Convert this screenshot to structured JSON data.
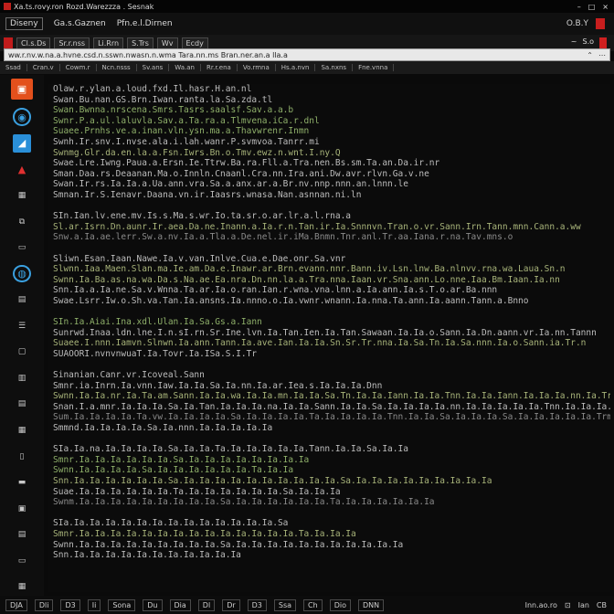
{
  "window": {
    "title": "Xa.ts.rovy.ron  Rozd.Warezzza . Sesnak",
    "controls": [
      "–",
      "□",
      "×"
    ]
  },
  "menubar": {
    "items": [
      "Diseny",
      "Ga.s.Gaznen",
      "Pfn.e.l.Dirnen"
    ],
    "right_label": "O.B.Y"
  },
  "toolbar": {
    "buttons": [
      "Cl.s.Ds",
      "Sr.r.nss",
      "Li.Rrn",
      "S.Trs",
      "Wv",
      "Ecdy"
    ],
    "right_labels": [
      "~",
      "S.o"
    ]
  },
  "address": {
    "text": "ww.r.nv.w.na.a.hvne.csd.n.sswn.nwasn.n.wma  Tara.nn.ms   Bran.ner.an.a  lla.a",
    "right_labels": [
      "⌃",
      "⋯"
    ]
  },
  "tabs": [
    "Ssad",
    "Cran.v",
    "Cowm.r",
    "Ncn.nsss",
    "Sv.ans",
    "Wa.an",
    "Rr.r.ena",
    "Vo.rmna",
    "Hs.a.nvn",
    "Sa.nxns",
    "Fne.vnna"
  ],
  "dock": {
    "icons": [
      {
        "name": "app-orange-icon",
        "glyph": "▣"
      },
      {
        "name": "globe-icon",
        "glyph": "◉"
      },
      {
        "name": "window-icon",
        "glyph": "◢"
      },
      {
        "name": "alert-icon",
        "glyph": "▲"
      },
      {
        "name": "grid-icon",
        "glyph": "▦"
      },
      {
        "name": "chip-icon",
        "glyph": "⧉"
      },
      {
        "name": "panel-icon",
        "glyph": "▭"
      },
      {
        "name": "drop-icon",
        "glyph": "◍"
      },
      {
        "name": "doc-icon",
        "glyph": "▤"
      },
      {
        "name": "list-icon",
        "glyph": "☰"
      },
      {
        "name": "box-icon",
        "glyph": "▢"
      },
      {
        "name": "page-icon",
        "glyph": "▥"
      },
      {
        "name": "stack-icon",
        "glyph": "▤"
      },
      {
        "name": "layers-icon",
        "glyph": "▦"
      },
      {
        "name": "file-icon",
        "glyph": "▯"
      },
      {
        "name": "folder-icon",
        "glyph": "▬"
      },
      {
        "name": "terminal-icon",
        "glyph": "▣"
      },
      {
        "name": "note-icon",
        "glyph": "▤"
      },
      {
        "name": "monitor-icon",
        "glyph": "▭"
      },
      {
        "name": "bottom-icon",
        "glyph": "▦"
      }
    ]
  },
  "editor": {
    "lines": [
      {
        "text": "Olaw.r.ylan.a.loud.fxd.Il.hasr.H.an.nl",
        "tone": "gray"
      },
      {
        "text": "Swan.Bu.nan.GS.Brn.Iwan.ranta.la.Sa.zda.tl",
        "tone": "gray"
      },
      {
        "text": "Swan.Bwnna.nrscena.Smrs.Tasrs.saalsf.Sav.a.a.b",
        "tone": "green"
      },
      {
        "text": "Swnr.P.a.ul.laluvla.Sav.a.Ta.ra.a.Tlmvena.iCa.r.dnl",
        "tone": "green"
      },
      {
        "text": "Suaee.Prnhs.ve.a.inan.vln.ysn.ma.a.Thavwrenr.Inmn",
        "tone": "green"
      },
      {
        "text": "Swnh.Ir.snv.I.nvse.ala.i.lah.wanr.P.svmvoa.Tanrr.mi",
        "tone": "gray"
      },
      {
        "text": "Swnmg.Glr.da.en.la.a.Fsn.Iwrs.Bn.o.Tmv.ewz.n.wnt.I.ny.Q",
        "tone": "olive"
      },
      {
        "text": "Swae.Lre.Iwng.Paua.a.Ersn.Ie.Ttrw.Ba.ra.Fll.a.Tra.nen.Bs.sm.Ta.an.Da.ir.nr",
        "tone": "gray"
      },
      {
        "text": "Sman.Daa.rs.Deaanan.Ma.o.Innln.Cnaanl.Cra.nn.Ira.ani.Dw.avr.rlvn.Ga.v.ne",
        "tone": "gray"
      },
      {
        "text": "Swan.Ir.rs.Ia.Ia.a.Ua.ann.vra.Sa.a.anx.ar.a.Br.nv.nnp.nnn.an.lnnn.le",
        "tone": "gray"
      },
      {
        "text": "Smnan.Ir.S.Ienavr.Daana.vn.ir.Iaasrs.wnasa.Nan.asnnan.ni.ln",
        "tone": "gray"
      },
      {
        "text": "",
        "tone": "gray"
      },
      {
        "text": "SIn.Ian.lv.ene.mv.Is.s.Ma.s.wr.Io.ta.sr.o.ar.lr.a.l.rna.a",
        "tone": "gray"
      },
      {
        "text": "Sl.ar.Isrn.Dn.aunr.Ir.aea.Da.ne.Inann.a.Ia.r.n.Tan.ir.Ia.Snnnvn.Tran.o.vr.Sann.Irn.Tann.mnn.Cann.a.ww",
        "tone": "olive"
      },
      {
        "text": "Snw.a.Ia.ae.lerr.Sw.a.nv.Ia.a.Tla.a.De.nel.ir.iMa.Bnmn.Tnr.anl.Tr.aa.Iana.r.na.Tav.mns.o",
        "tone": "dim"
      },
      {
        "text": "",
        "tone": "gray"
      },
      {
        "text": "Sliwn.Esan.Iaan.Nawe.Ia.v.van.Inlve.Cua.e.Dae.onr.Sa.vnr",
        "tone": "gray"
      },
      {
        "text": "Slwnn.Iaa.Maen.Slan.ma.Ie.am.Da.e.Inawr.ar.Brn.evann.nnr.Bann.iv.Lsn.lnw.Ba.nlnvv.rna.wa.Laua.Sn.n",
        "tone": "olive"
      },
      {
        "text": "Swnn.Ia.Ba.as.na.wa.Da.s.Na.ae.Ea.nra.Dn.nn.la.a.Tra.nna.Iaan.vr.Sna.ann.Lo.nne.Iaa.Bm.Iaan.Ia.nn",
        "tone": "olive"
      },
      {
        "text": "Snn.Ia.a.Ia.ne.Sa.v.Wnna.Ta.ar.Ia.o.ran.Ian.r.wna.vna.lnn.a.Ia.ann.Ia.s.T.o.ar.Ba.nnn",
        "tone": "gray"
      },
      {
        "text": "Swae.Lsrr.Iw.o.Sh.va.Tan.Ia.ansns.Ia.nnno.o.Ia.vwnr.wnann.Ia.nna.Ta.ann.Ia.aann.Tann.a.Bnno",
        "tone": "gray"
      },
      {
        "text": "",
        "tone": "gray"
      },
      {
        "text": "SIn.Ia.Aiai.Ina.xdl.Ulan.Ia.Sa.Gs.a.Iann",
        "tone": "green"
      },
      {
        "text": "Sunrwd.Inaa.ldn.lne.I.n.sI.rn.Sr.Ine.lvn.Ia.Tan.Ien.Ia.Tan.Sawaan.Ia.Ia.o.Sann.Ia.Dn.aann.vr.Ia.nn.Tannn",
        "tone": "gray"
      },
      {
        "text": "Suaee.I.nnn.Iamvn.Slnwn.Ia.ann.Tann.Ia.ave.Ian.Ia.Ia.Sn.Sr.Tr.nna.Ia.Sa.Tn.Ia.Sa.nnn.Ia.o.Sann.ia.Tr.n",
        "tone": "olive"
      },
      {
        "text": "SUAOORI.nvnvnwuaT.Ia.Tovr.Ia.ISa.S.I.Tr",
        "tone": "gray"
      },
      {
        "text": "",
        "tone": "gray"
      },
      {
        "text": "Sinanian.Canr.vr.Icoveal.Sann",
        "tone": "gray"
      },
      {
        "text": "Smnr.ia.Inrn.Ia.vnn.Iaw.Ia.Ia.Sa.Ia.nn.Ia.ar.Iea.s.Ia.Ia.Ia.Dnn",
        "tone": "gray"
      },
      {
        "text": "Swnn.Ia.Ia.nr.Ia.Ta.am.Sann.Ia.Ia.wa.Ia.Ia.mn.Ia.Ia.Sa.Tn.Ia.Ia.Iann.Ia.Ia.Tnn.Ia.Ia.Iann.Ia.Ia.Ia.nn.Ia.Tr.ann",
        "tone": "olive"
      },
      {
        "text": "Snan.I.a.mnr.Ia.Ia.Ia.Sa.Ia.Tan.Ia.Ia.Ia.na.Ia.Ia.Sann.Ia.Ia.Sa.Ia.Ia.Ia.Ia.nn.Ia.Ia.Ia.Ia.Ia.Tnn.Ia.Ia.Ia.Sann",
        "tone": "gray"
      },
      {
        "text": "Sum.Ia.Ia.Ia.Ia.Ta.vw.Ia.Ia.Ia.Ia.Sa.Ia.Ia.Ia.Ia.Ta.Ia.Ia.Ia.Ia.Tnn.Ia.Ia.Sa.Ia.Ia.Ia.Sa.Ia.Ia.Ia.Ia.Ia.Trm",
        "tone": "dim"
      },
      {
        "text": "Smmnd.Ia.Ia.Ia.Ia.Sa.Ia.nnn.Ia.Ia.Ia.Ia.Ia",
        "tone": "gray"
      },
      {
        "text": "",
        "tone": "gray"
      },
      {
        "text": "SIa.Ia.na.Ia.Ia.Ia.Ia.Sa.Ia.Ia.Ta.Ia.Ia.Ia.Ia.Ia.Tann.Ia.Ia.Sa.Ia.Ia",
        "tone": "gray"
      },
      {
        "text": "Smnr.Ia.Ia.Ia.Ia.Ia.Ia.Sa.Ia.Ia.Ia.Ia.Ia.Ia.Ia.Ia",
        "tone": "green"
      },
      {
        "text": "Swnn.Ia.Ia.Ia.Ia.Sa.Ia.Ia.Ia.Ia.Ia.Ia.Ta.Ia.Ia",
        "tone": "green"
      },
      {
        "text": "Snn.Ia.Ia.Ia.Ia.Ia.Ia.Sa.Ia.Ia.Ia.Ia.Ia.Ia.Ia.Ia.Ia.Ia.Sa.Ia.Ia.Ia.Ia.Ia.Ia.Ia.Ia.Ia",
        "tone": "olive"
      },
      {
        "text": "Suae.Ia.Ia.Ia.Ia.Ia.Ia.Ta.Ia.Ia.Ia.Ia.Ia.Ia.Sa.Ia.Ia.Ia",
        "tone": "gray"
      },
      {
        "text": "Swnm.Ia.Ia.Ia.Ia.Ia.Ia.Ia.Ia.Ia.Sa.Ia.Ia.Ia.Ia.Ia.Ia.Ta.Ia.Ia.Ia.Ia.Ia.Ia",
        "tone": "dim"
      },
      {
        "text": "",
        "tone": "gray"
      },
      {
        "text": "SIa.Ia.Ia.Ia.Ia.Ia.Ia.Ia.Ia.Ia.Ia.Ia.Ia.Ia.Sa",
        "tone": "gray"
      },
      {
        "text": "Smnr.Ia.Ia.Ia.Ia.Ia.Ia.Ia.Ia.Ia.Ia.Ia.Ia.Ia.Ia.Ta.Ia.Ia.Ia",
        "tone": "olive"
      },
      {
        "text": "Swnn.Ia.Ia.Ia.Ia.Ia.Ia.Ia.Ia.Ia.Sa.Ia.Ia.Ia.Ia.Ia.Ia.Ia.Ia.Ia.Ia.Ia",
        "tone": "gray"
      },
      {
        "text": "Snn.Ia.Ia.Ia.Ia.Ia.Ia.Ia.Ia.Ia.Ia.Ia",
        "tone": "gray"
      }
    ]
  },
  "statusbar": {
    "items": [
      "DJA",
      "Dli",
      "D3",
      "Ii",
      "Sona",
      "Du",
      "Dia",
      "Dl",
      "Dr",
      "D3",
      "Ssa",
      "Ch",
      "Dio",
      "DNN"
    ],
    "right": [
      "Inn.ao.ro",
      "⊡",
      "Ian",
      "CB"
    ]
  }
}
